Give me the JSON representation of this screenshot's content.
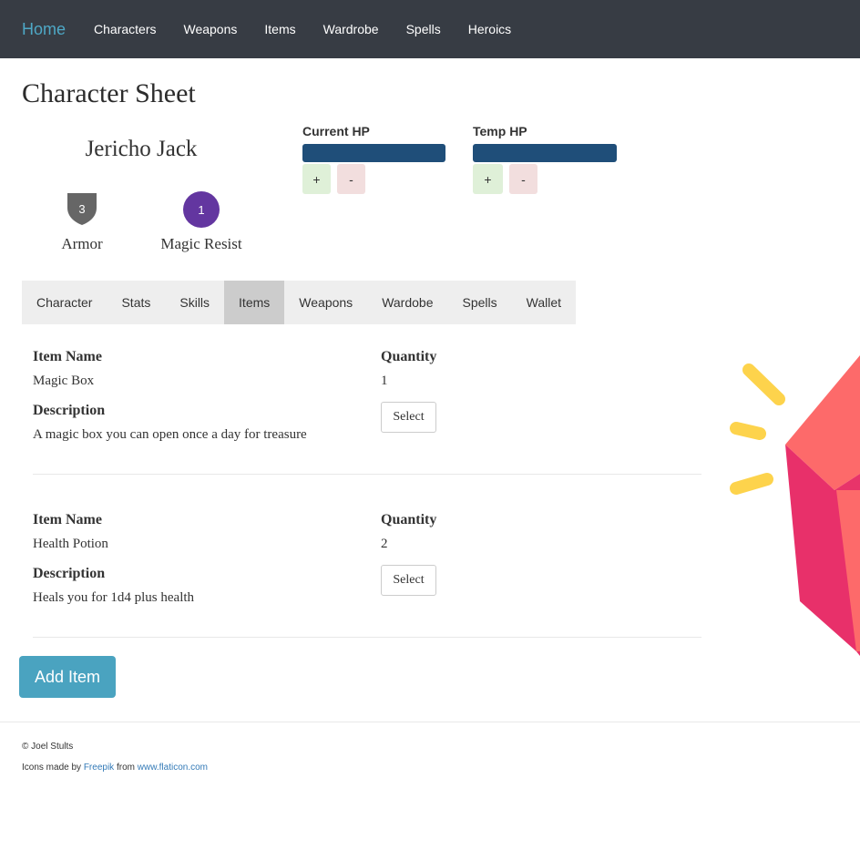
{
  "nav": {
    "brand": "Home",
    "links": [
      "Characters",
      "Weapons",
      "Items",
      "Wardrobe",
      "Spells",
      "Heroics"
    ]
  },
  "page": {
    "title": "Character Sheet"
  },
  "character": {
    "name": "Jericho Jack",
    "armor": {
      "value": "3",
      "label": "Armor"
    },
    "magic_resist": {
      "value": "1",
      "label": "Magic Resist"
    }
  },
  "hp": {
    "current": {
      "label": "Current HP",
      "plus": "+",
      "minus": "-"
    },
    "temp": {
      "label": "Temp HP",
      "plus": "+",
      "minus": "-"
    }
  },
  "tabs": [
    "Character",
    "Stats",
    "Skills",
    "Items",
    "Weapons",
    "Wardobe",
    "Spells",
    "Wallet"
  ],
  "active_tab": "Items",
  "items": [
    {
      "name_label": "Item Name",
      "name": "Magic Box",
      "quantity_label": "Quantity",
      "quantity": "1",
      "description_label": "Description",
      "description": "A magic box you can open once a day for treasure",
      "select_label": "Select"
    },
    {
      "name_label": "Item Name",
      "name": "Health Potion",
      "quantity_label": "Quantity",
      "quantity": "2",
      "description_label": "Description",
      "description": "Heals you for 1d4 plus health",
      "select_label": "Select"
    }
  ],
  "add_item_label": "Add Item",
  "footer": {
    "copyright": "© Joel Stults",
    "credit_prefix": "Icons made by",
    "credit_author": "Freepik",
    "credit_mid": "from",
    "credit_site": "www.flaticon.com"
  },
  "icons": {
    "armor": "shield-icon",
    "magic_resist": "circle-icon",
    "decoration": "gem-icon"
  },
  "colors": {
    "navbar": "#373c44",
    "brand": "#4ea8c6",
    "hp_bar": "#1f4e79",
    "armor": "#666666",
    "magic_resist": "#6336a0",
    "add_button": "#4aa3c0",
    "active_tab": "#cccccc"
  }
}
